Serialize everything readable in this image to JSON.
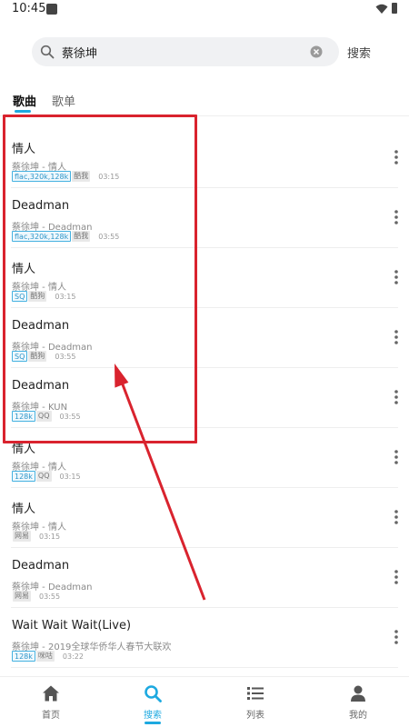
{
  "status_bar": {
    "time": "10:45"
  },
  "search": {
    "query": "蔡徐坤",
    "button_label": "搜索"
  },
  "tabs": [
    {
      "label": "歌曲",
      "active": true
    },
    {
      "label": "歌单",
      "active": false
    }
  ],
  "songs": [
    {
      "title": "情人",
      "subtitle": "蔡徐坤 - 情人",
      "quality": "flac,320k,128k",
      "source": "酷我",
      "duration": "03:15"
    },
    {
      "title": "Deadman",
      "subtitle": "蔡徐坤 - Deadman",
      "quality": "flac,320k,128k",
      "source": "酷我",
      "duration": "03:55"
    },
    {
      "title": "情人",
      "subtitle": "蔡徐坤 - 情人",
      "quality": "SQ",
      "source": "酷狗",
      "duration": "03:15"
    },
    {
      "title": "Deadman",
      "subtitle": "蔡徐坤 - Deadman",
      "quality": "SQ",
      "source": "酷狗",
      "duration": "03:55"
    },
    {
      "title": "Deadman",
      "subtitle": "蔡徐坤 - KUN",
      "quality": "128k",
      "source": "QQ",
      "duration": "03:55"
    },
    {
      "title": "情人",
      "subtitle": "蔡徐坤 - 情人",
      "quality": "128k",
      "source": "QQ",
      "duration": "03:15"
    },
    {
      "title": "情人",
      "subtitle": "蔡徐坤 - 情人",
      "quality": "",
      "source": "网易",
      "duration": "03:15"
    },
    {
      "title": "Deadman",
      "subtitle": "蔡徐坤 - Deadman",
      "quality": "",
      "source": "网易",
      "duration": "03:55"
    },
    {
      "title": "Wait Wait Wait(Live)",
      "subtitle": "蔡徐坤 - 2019全球华侨华人春节大联欢",
      "quality": "128k",
      "source": "咪咕",
      "duration": "03:22"
    }
  ],
  "bottom_nav": [
    {
      "label": "首页",
      "icon": "home-icon",
      "active": false
    },
    {
      "label": "搜索",
      "icon": "search-icon",
      "active": true
    },
    {
      "label": "列表",
      "icon": "list-icon",
      "active": false
    },
    {
      "label": "我的",
      "icon": "person-icon",
      "active": false
    }
  ],
  "colors": {
    "accent": "#1da9e0",
    "annotation": "#d9232e"
  }
}
